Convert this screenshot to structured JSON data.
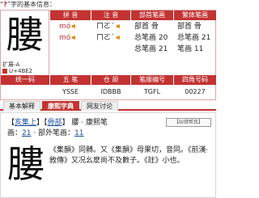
{
  "title": {
    "prefix": "“",
    "char_mark": "?",
    "suffix": "”字的基本信息："
  },
  "info": {
    "char": "膢",
    "headers": {
      "pinyin": "拼  音",
      "zhuyin": "注  音",
      "bushou": "部首笔画",
      "fanti": "繁体笔画"
    },
    "rows": [
      {
        "pinyin": "mó",
        "zhuyin": "ㄇㄛˊ",
        "label": "部首",
        "value": "骨"
      },
      {
        "pinyin": "mó",
        "zhuyin": "ㄇㄛˊ",
        "label": "总笔画",
        "value": "20"
      }
    ],
    "bihua_row": {
      "label": "总笔画",
      "value": "21"
    },
    "right_col": {
      "label1": "部首",
      "value1": "骨",
      "label2": "总笔画",
      "value2": "21",
      "label3": "笔画",
      "value3": "11"
    },
    "left_lines": {
      "l1": "扩展-A",
      "l2": "U+4BE2"
    },
    "code_headers": {
      "unified": "统一码",
      "wubi": "五  笔",
      "cangjie": "仓  颉",
      "bishun": "笔顺编号",
      "sijiao": "四角号码"
    },
    "codes": {
      "wubi": "YSSE",
      "cangjie": "IDBBB",
      "bishun": "TGFL",
      "sijiao": "00227"
    }
  },
  "tabs": [
    {
      "label": "基本解释",
      "active": false
    },
    {
      "label": "康熙字典",
      "active": true
    },
    {
      "label": "网友讨论",
      "active": false
    }
  ],
  "dict": {
    "line1_a": "【",
    "line1_b": "亥集上",
    "line1_c": "】【",
    "line1_d": "骨部",
    "line1_e": "】 膢 · 康熙笔",
    "line2_a": "画：",
    "line2_b": "21",
    "line2_c": " · 部外笔画：",
    "line2_d": "11",
    "correct": "【纠错帮我】",
    "char": "膢",
    "body": "《集韻》同髆。又《集韻》母果切，音同。《前漢·敘傳》又况幺麽尚不及數子。《註》小也。"
  }
}
